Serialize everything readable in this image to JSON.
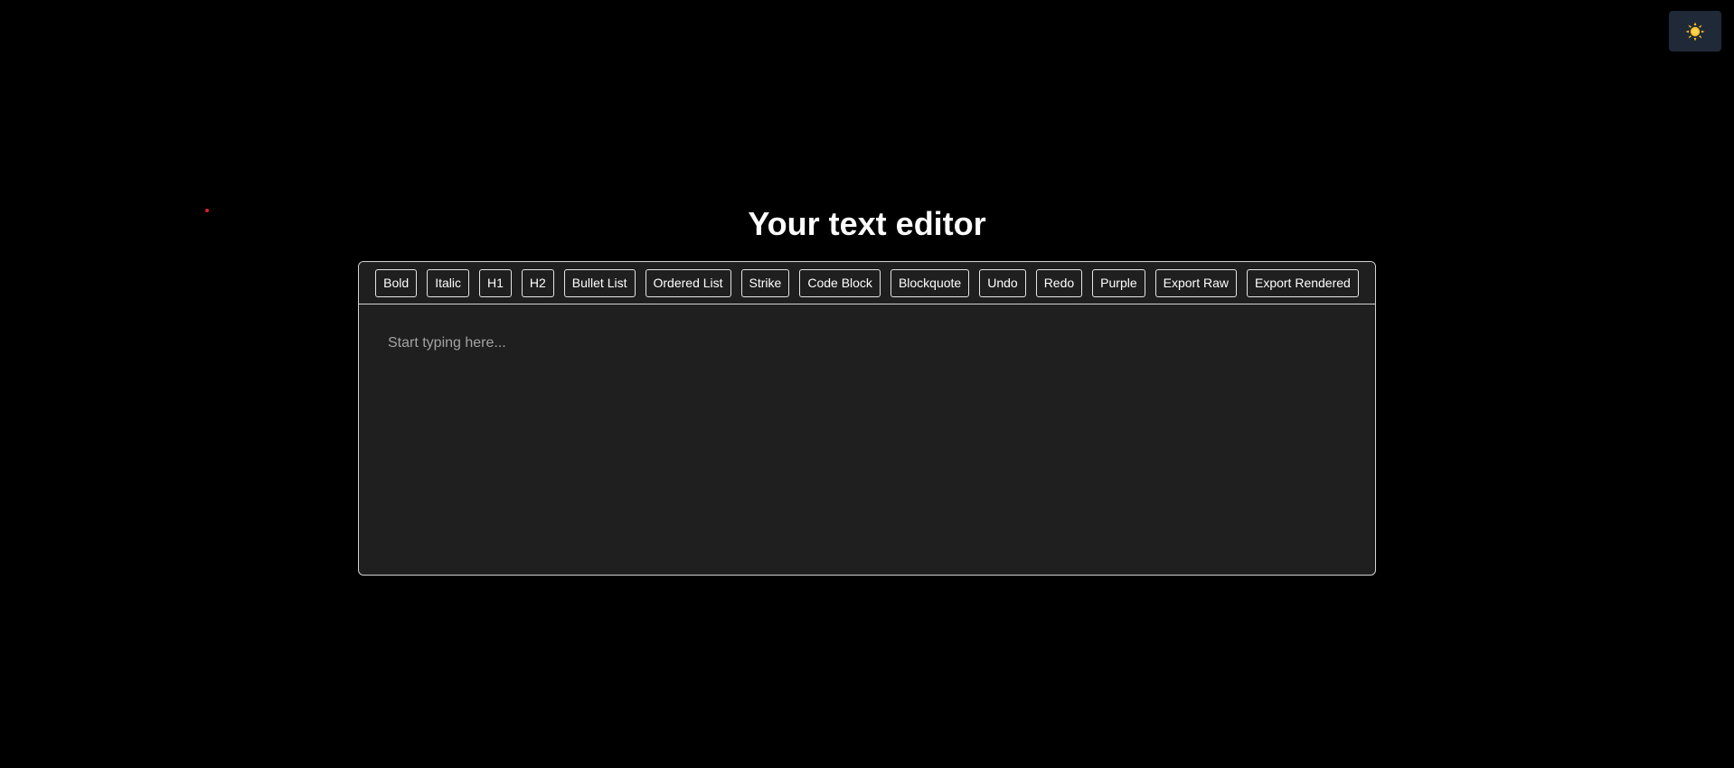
{
  "page": {
    "title": "Your text editor"
  },
  "theme_toggle": {
    "icon": "sun-icon",
    "bg_color": "#1f2937",
    "icon_color": "#fbbf24"
  },
  "toolbar": {
    "buttons": [
      {
        "name": "bold",
        "label": "Bold"
      },
      {
        "name": "italic",
        "label": "Italic"
      },
      {
        "name": "h1",
        "label": "H1"
      },
      {
        "name": "h2",
        "label": "H2"
      },
      {
        "name": "bullet-list",
        "label": "Bullet List"
      },
      {
        "name": "ordered-list",
        "label": "Ordered List"
      },
      {
        "name": "strike",
        "label": "Strike"
      },
      {
        "name": "code-block",
        "label": "Code Block"
      },
      {
        "name": "blockquote",
        "label": "Blockquote"
      },
      {
        "name": "undo",
        "label": "Undo"
      },
      {
        "name": "redo",
        "label": "Redo"
      },
      {
        "name": "purple",
        "label": "Purple"
      },
      {
        "name": "export-raw",
        "label": "Export Raw"
      },
      {
        "name": "export-rendered",
        "label": "Export Rendered"
      }
    ]
  },
  "editor": {
    "placeholder": "Start typing here..."
  },
  "colors": {
    "background": "#000000",
    "editor_bg": "#1f1f1f",
    "border": "#d4d4d4",
    "text": "#ffffff",
    "placeholder": "#a3a3a3",
    "marker": "#e11d2e"
  }
}
